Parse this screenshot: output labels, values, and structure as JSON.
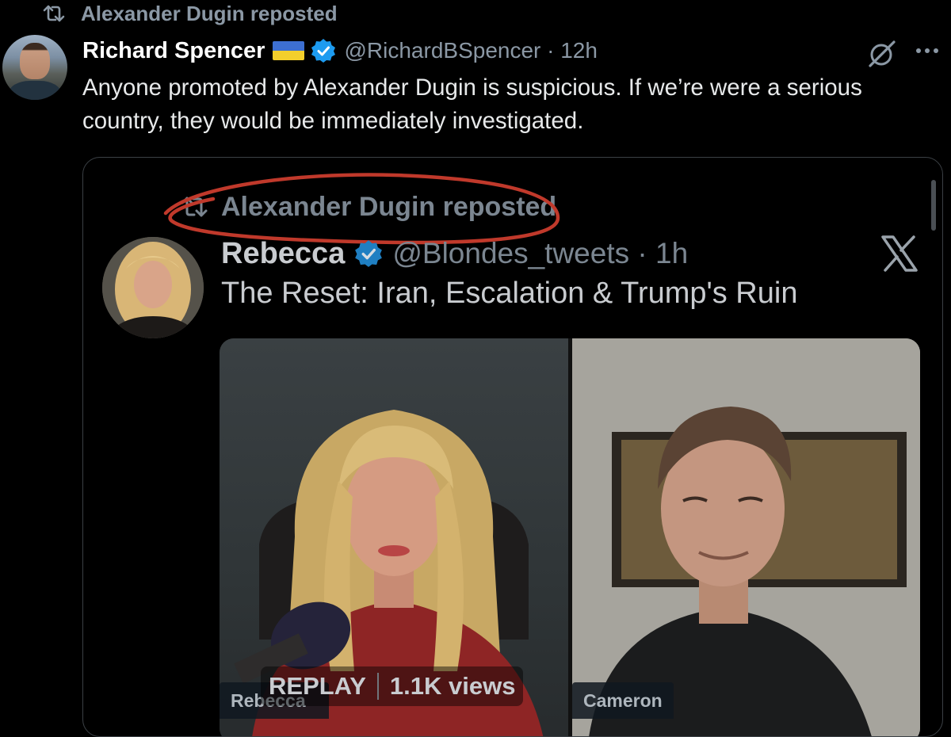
{
  "repost_header": {
    "label": "Alexander Dugin reposted",
    "icon": "repost-icon"
  },
  "tweet": {
    "author_name": "Richard Spencer",
    "flag": "ukraine-flag",
    "handle_time": "@RichardBSpencer · 12h",
    "text": "Anyone promoted by Alexander Dugin is suspicious. If we’re were a serious country, they would be immediately investigated."
  },
  "quoted_screenshot": {
    "repost_label": "Alexander Dugin reposted",
    "author_name": "Rebecca",
    "handle_time": "@Blondes_tweets · 1h",
    "text": "The Reset: Iran, Escalation & Trump's Ruin",
    "video": {
      "replay_label": "REPLAY",
      "views_label": "1.1K views",
      "left_speaker": "Rebecca",
      "right_speaker": "Cameron"
    }
  },
  "colors": {
    "background": "#000000",
    "verified_blue": "#1d9bf0",
    "annotation_red": "#c0392b",
    "muted_text": "#8b98a5"
  }
}
